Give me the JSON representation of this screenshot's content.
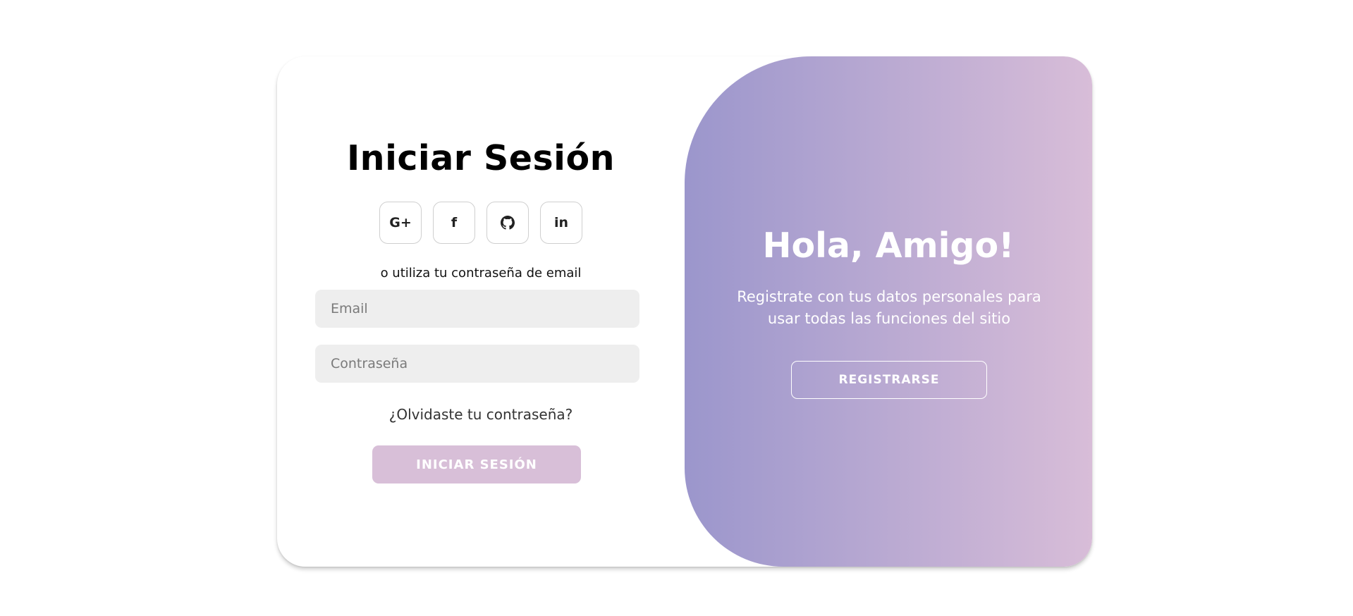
{
  "login": {
    "title": "Iniciar Sesión",
    "social": [
      {
        "icon": "google-plus-icon",
        "label": "G+"
      },
      {
        "icon": "facebook-icon",
        "label": "f"
      },
      {
        "icon": "github-icon",
        "label": ""
      },
      {
        "icon": "linkedin-icon",
        "label": "in"
      }
    ],
    "subtitle": "o utiliza tu contraseña de email",
    "email_placeholder": "Email",
    "password_placeholder": "Contraseña",
    "forgot": "¿Olvidaste tu contraseña?",
    "button": "INICIAR SESIÓN"
  },
  "signup": {
    "title": "Hola, Amigo!",
    "text": "Registrate con tus datos personales para usar todas las funciones del sitio",
    "button": "REGISTRARSE"
  },
  "colors": {
    "accent_light": "#d8bfd8",
    "gradient_start": "#9b96cc",
    "gradient_end": "#d8bdd8",
    "input_bg": "#eeeeee"
  }
}
